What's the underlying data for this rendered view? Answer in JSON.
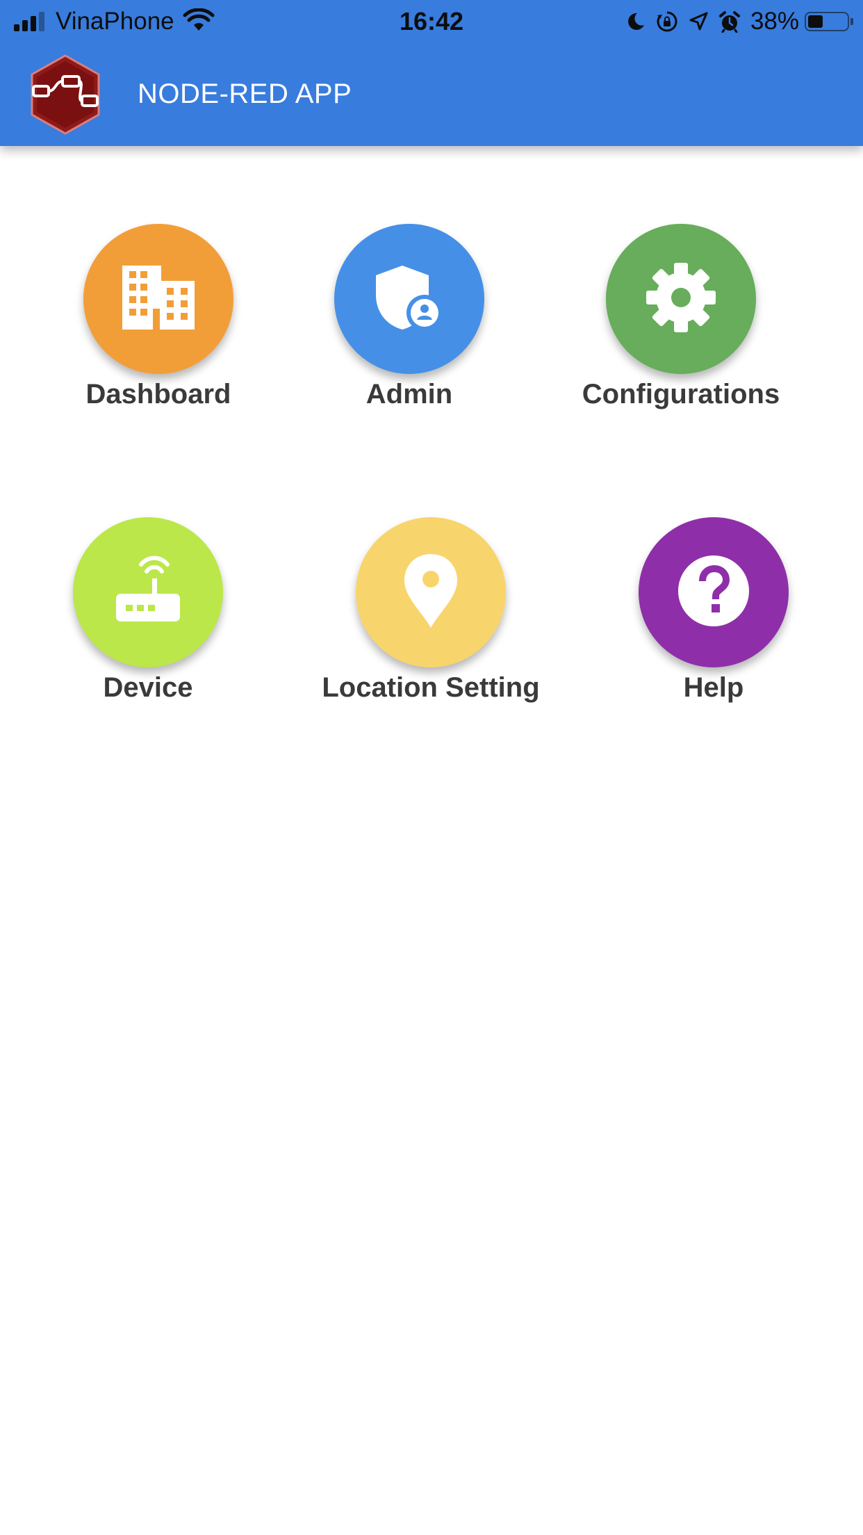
{
  "status_bar": {
    "carrier": "VinaPhone",
    "time": "16:42",
    "battery_percent": "38%",
    "battery_level": 0.38,
    "icons": [
      "signal-icon",
      "wifi-icon",
      "moon-icon",
      "rotation-lock-icon",
      "location-arrow-icon",
      "alarm-icon",
      "battery-icon"
    ]
  },
  "app_bar": {
    "title": "NODE-RED APP",
    "logo_icon": "node-red-logo-icon",
    "color": "#387CDD"
  },
  "menu": {
    "items": [
      {
        "label": "Dashboard",
        "icon": "building-icon",
        "color": "#F29E38"
      },
      {
        "label": "Admin",
        "icon": "admin-shield-icon",
        "color": "#4590E6"
      },
      {
        "label": "Configurations",
        "icon": "gear-icon",
        "color": "#67AD5B"
      },
      {
        "label": "Device",
        "icon": "router-icon",
        "color": "#BBE74A"
      },
      {
        "label": "Location Setting",
        "icon": "location-pin-icon",
        "color": "#F8D56C"
      },
      {
        "label": "Help",
        "icon": "help-icon",
        "color": "#8E2FA9"
      }
    ]
  }
}
